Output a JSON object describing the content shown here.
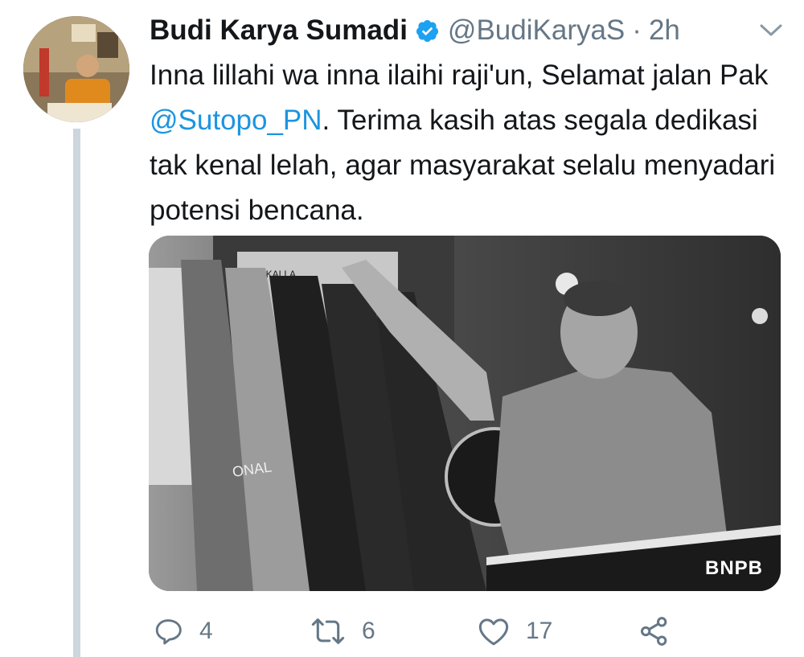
{
  "author": {
    "name": "Budi Karya Sumadi",
    "handle": "@BudiKaryaS",
    "separator": "·",
    "time": "2h",
    "verified": true
  },
  "tweet": {
    "text_before": "Inna lillahi wa inna ilaihi raji'un, Selamat jalan Pak ",
    "mention": "@Sutopo_PN",
    "text_after": ". Terima kasih atas segala dedikasi tak kenal lelah, agar masyarakat selalu menyadari potensi bencana."
  },
  "media": {
    "credit": "BNPB",
    "flag_text": "ONAL",
    "banner_text": "F KALLA"
  },
  "actions": {
    "reply_count": "4",
    "retweet_count": "6",
    "like_count": "17"
  },
  "colors": {
    "accent": "#1b95e0",
    "muted": "#657786",
    "verified": "#1da1f2",
    "thread_line": "#ccd6dd"
  },
  "icons": [
    "reply-icon",
    "retweet-icon",
    "like-icon",
    "share-icon",
    "verified-badge-icon",
    "chevron-down-icon"
  ]
}
